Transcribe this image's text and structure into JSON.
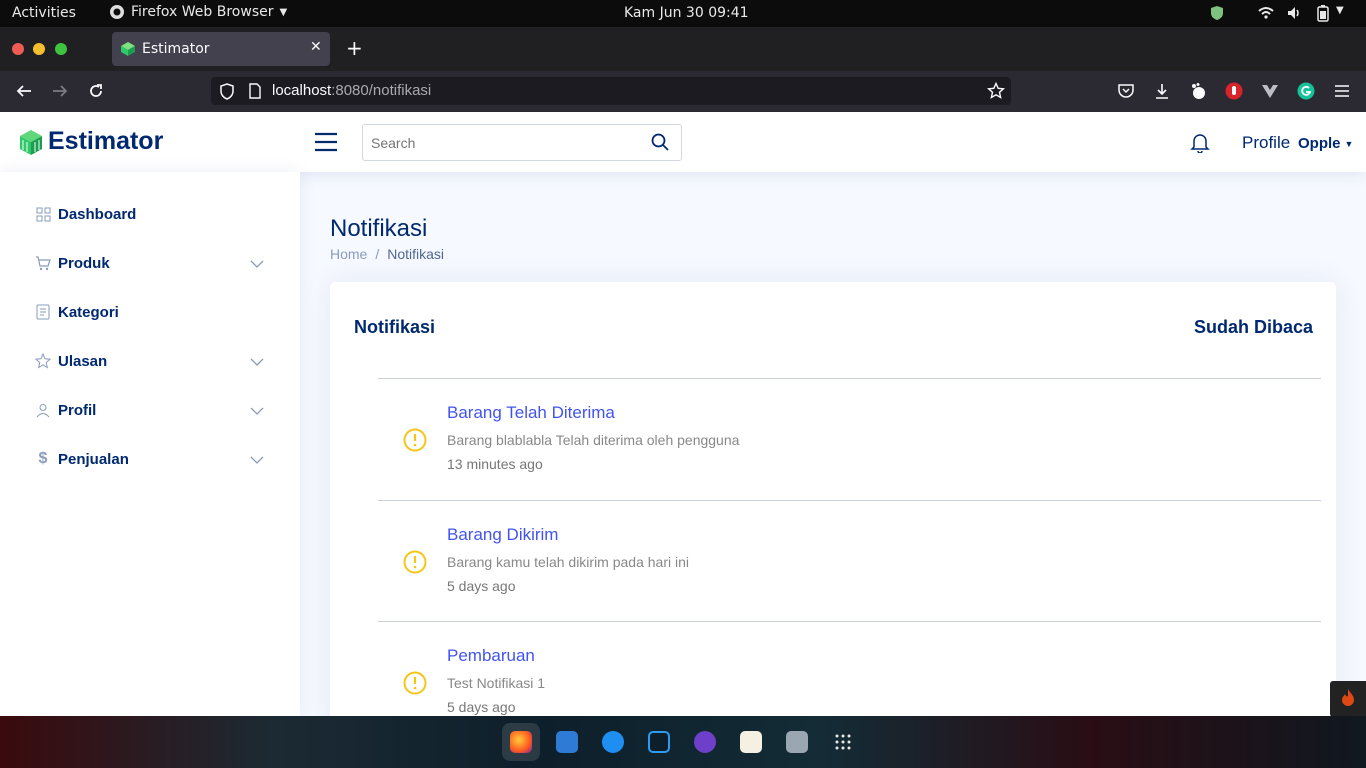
{
  "system_bar": {
    "activities": "Activities",
    "app_name": "Firefox Web Browser",
    "clock": "Kam Jun 30  09:41"
  },
  "browser": {
    "tab_title": "Estimator",
    "url_host": "localhost",
    "url_path": ":8080/notifikasi"
  },
  "app": {
    "brand": "Estimator",
    "search_placeholder": "Search",
    "profile_label": "Profile",
    "user_name": "Opple",
    "sidebar": [
      {
        "label": "Dashboard",
        "icon": "grid-icon",
        "expandable": false
      },
      {
        "label": "Produk",
        "icon": "cart-icon",
        "expandable": true
      },
      {
        "label": "Kategori",
        "icon": "list-icon",
        "expandable": false
      },
      {
        "label": "Ulasan",
        "icon": "star-icon",
        "expandable": true
      },
      {
        "label": "Profil",
        "icon": "person-icon",
        "expandable": true
      },
      {
        "label": "Penjualan",
        "icon": "dollar-icon",
        "expandable": true
      }
    ],
    "page_title": "Notifikasi",
    "breadcrumb": {
      "home": "Home",
      "separator": "/",
      "current": "Notifikasi"
    },
    "card": {
      "title": "Notifikasi",
      "mark_read": "Sudah Dibaca",
      "notifications": [
        {
          "title": "Barang Telah Diterima",
          "message": "Barang blablabla Telah diterima oleh pengguna",
          "time": "13 minutes ago"
        },
        {
          "title": "Barang Dikirim",
          "message": "Barang kamu telah dikirim pada hari ini",
          "time": "5 days ago"
        },
        {
          "title": "Pembaruan",
          "message": "Test Notifikasi 1",
          "time": "5 days ago"
        }
      ]
    }
  },
  "colors": {
    "brand_dark": "#012970",
    "link_blue": "#4154f1",
    "warning": "#f5c518",
    "brand_green": "#2eca6a"
  }
}
